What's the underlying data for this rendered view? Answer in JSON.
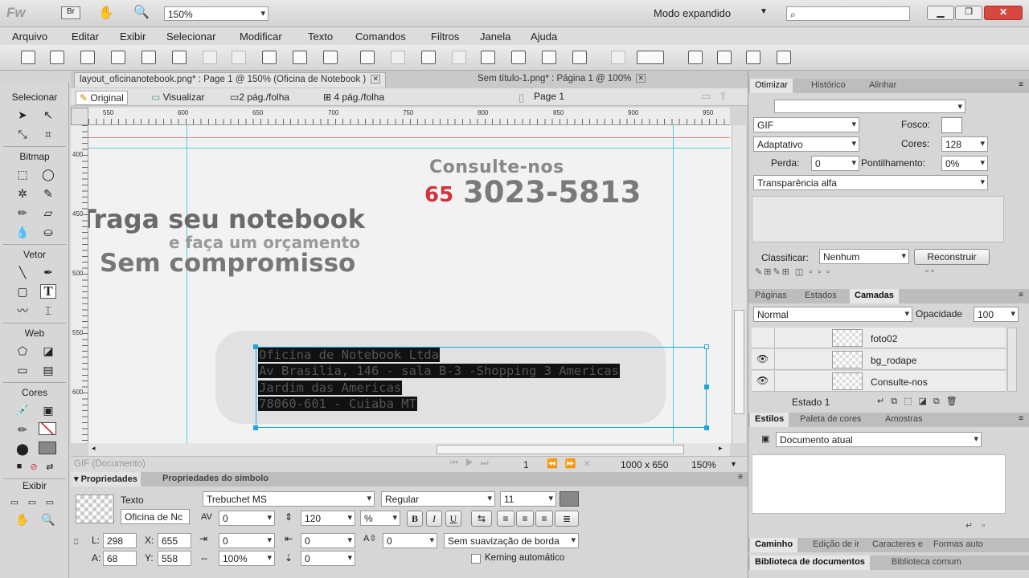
{
  "app": {
    "logo": "Fw",
    "bridge": "Br",
    "zoom": "150%",
    "workspace": "Modo expandido"
  },
  "menu": [
    "Arquivo",
    "Editar",
    "Exibir",
    "Selecionar",
    "Modificar",
    "Texto",
    "Comandos",
    "Filtros",
    "Janela",
    "Ajuda"
  ],
  "doc_tabs": [
    {
      "label": "layout_oficinanotebook.png* : Page 1 @ 150% (Oficina de Notebook )",
      "active": true
    },
    {
      "label": "Sem título-1.png* : Página 1 @ 100%",
      "active": false
    }
  ],
  "view_buttons": [
    "Original",
    "Visualizar",
    "2 pág./folha",
    "4 pág./folha"
  ],
  "page_label": "Page 1",
  "ruler_h": [
    "550",
    "600",
    "650",
    "700",
    "750",
    "800",
    "850",
    "900",
    "950"
  ],
  "ruler_v": [
    "400",
    "450",
    "500",
    "550",
    "600"
  ],
  "tools": {
    "select_h": "Selecionar",
    "bitmap_h": "Bitmap",
    "vector_h": "Vetor",
    "web_h": "Web",
    "colors_h": "Cores",
    "view_h": "Exibir"
  },
  "canvas": {
    "consulte": "Consulte-nos",
    "ddd": "65",
    "phone": "3023-5813",
    "line1": "Traga seu notebook",
    "line2": "e faça um orçamento",
    "line3": "Sem compromisso",
    "address": [
      "Oficina de Notebook Ltda",
      "Av Brasilia, 146 - sala B-3 -Shopping 3 Americas",
      "Jardim das Americas",
      "78060-601 - Cuiaba MT"
    ]
  },
  "status": {
    "left": "GIF (Documento)",
    "page": "1",
    "size": "1000 x 650",
    "zoom": "150%"
  },
  "props": {
    "tabs": [
      "Propriedades",
      "Propriedades do símbolo"
    ],
    "type": "Texto",
    "name": "Oficina de Nc",
    "font": "Trebuchet MS",
    "style": "Regular",
    "size": "11",
    "kerning": "0",
    "leading": "120",
    "leading_unit": "%",
    "bold": "B",
    "italic": "I",
    "underline": "U",
    "indent": "0",
    "space_before": "0",
    "space_after": "0",
    "baseline": "0",
    "scale": "100%",
    "aa": "Sem suavização de borda",
    "auto_kern": "Kerning automático",
    "L": "298",
    "X": "655",
    "A": "68",
    "Y": "558"
  },
  "optimize": {
    "tabs": [
      "Otimizar",
      "Histórico",
      "Alinhar"
    ],
    "format": "GIF",
    "matte_label": "Fosco:",
    "palette": "Adaptativo",
    "colors_label": "Cores:",
    "colors": "128",
    "loss_label": "Perda:",
    "loss": "0",
    "dither_label": "Pontilhamento:",
    "dither": "0%",
    "transparency": "Transparência alfa",
    "sort_label": "Classificar:",
    "sort": "Nenhum",
    "rebuild": "Reconstruir"
  },
  "layers": {
    "tabs": [
      "Páginas",
      "Estados",
      "Camadas"
    ],
    "blend": "Normal",
    "opacity_label": "Opacidade",
    "opacity": "100",
    "items": [
      "foto02",
      "bg_rodape",
      "Consulte-nos"
    ],
    "state": "Estado 1"
  },
  "styles": {
    "tabs": [
      "Estilos",
      "Paleta de cores",
      "Amostras"
    ],
    "current": "Documento atual"
  },
  "bottom_tabs": [
    "Caminho",
    "Edição de ir",
    "Caracteres e",
    "Formas auto"
  ],
  "bottom_tabs2": [
    "Biblioteca de documentos",
    "Biblioteca comum"
  ],
  "colors": {
    "accent_red": "#d3333a",
    "guide": "#4fd0e0",
    "phone_gray": "#7a7a7a"
  }
}
